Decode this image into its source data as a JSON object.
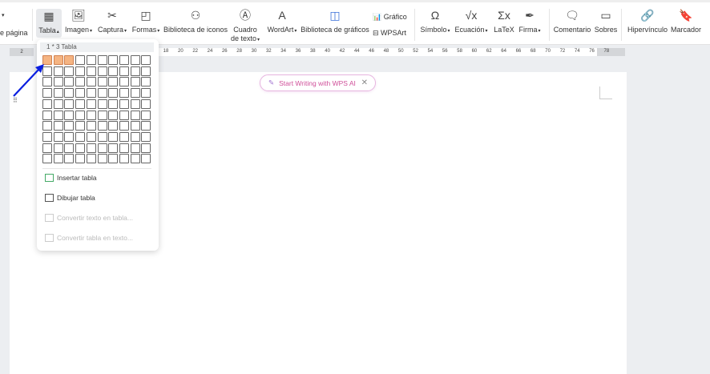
{
  "toolbar": {
    "partial_label": "e página",
    "tabla": "Tabla",
    "imagen": "Imagen",
    "captura": "Captura",
    "formas": "Formas",
    "biblioteca_iconos": "Biblioteca de iconos",
    "cuadro_l1": "Cuadro",
    "cuadro_l2": "de texto",
    "wordart": "WordArt",
    "biblioteca_graficos": "Biblioteca de gráficos",
    "grafico": "Gráfico",
    "wpsart": "WPSArt",
    "simbolo": "Símbolo",
    "ecuacion": "Ecuación",
    "latex": "LaTeX",
    "firma": "Firma",
    "comentario": "Comentario",
    "sobres": "Sobres",
    "hipervinculo": "Hipervínculo",
    "marcador": "Marcador"
  },
  "ruler": {
    "left_label": "2",
    "ticks": [
      "18",
      "20",
      "22",
      "24",
      "26",
      "28",
      "30",
      "32",
      "34",
      "36",
      "38",
      "40",
      "42",
      "44",
      "46",
      "48",
      "50",
      "52",
      "54",
      "56",
      "58",
      "60",
      "62",
      "64",
      "66",
      "68",
      "70",
      "72",
      "74",
      "76",
      "78"
    ]
  },
  "ai_pill": {
    "label": "Start Writing with WPS AI"
  },
  "table_dropdown": {
    "header": "1 * 3 Tabla",
    "rows": 10,
    "cols": 10,
    "selected_rows": 1,
    "selected_cols": 3,
    "highlight_color": "#f5b482",
    "items": [
      {
        "label": "Insertar tabla",
        "enabled": true
      },
      {
        "label": "Dibujar tabla",
        "enabled": true
      },
      {
        "label": "Convertir texto en tabla...",
        "enabled": false
      },
      {
        "label": "Convertir tabla en texto...",
        "enabled": false
      }
    ]
  },
  "annotation": {
    "arrow_color": "#0a1ee0"
  }
}
